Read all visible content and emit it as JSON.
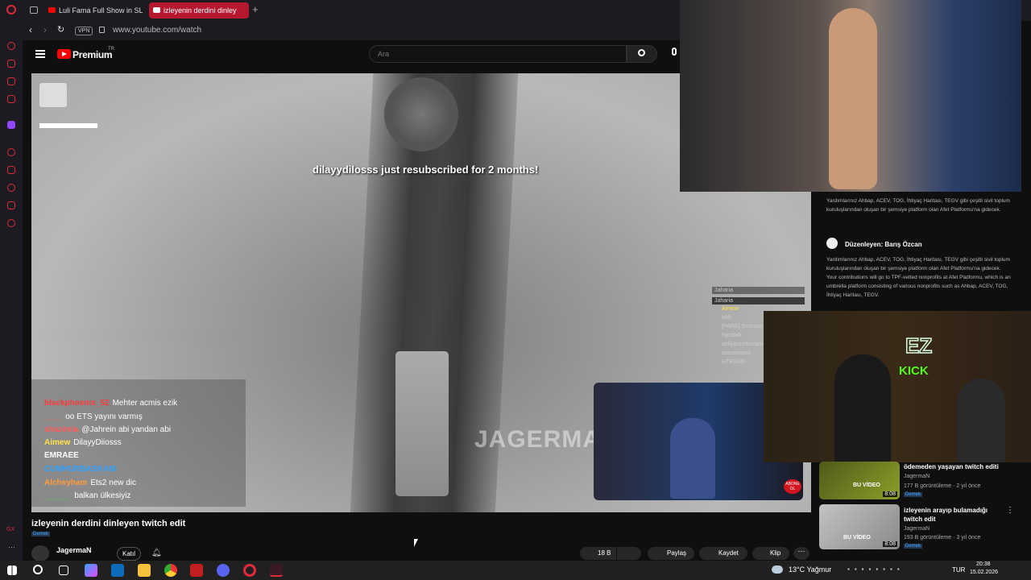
{
  "browser": {
    "tabs": [
      {
        "label": "Luli Fama Full Show in SLC"
      },
      {
        "label": "izleyenin derdini dinley"
      }
    ],
    "vpn_badge": "VPN",
    "url": "www.youtube.com/watch"
  },
  "youtube": {
    "brand": "Premium",
    "brand_sup": "TR",
    "search_placeholder": "Ara"
  },
  "video": {
    "sub_alert": "dilayydilosss just resubscribed for 2 months!",
    "watermark": "JAGERMAN",
    "chat": [
      {
        "user": "blackphoenix_52",
        "color": "#ff3b3b",
        "msg": "Mehter acmis ezik"
      },
      {
        "user": "____",
        "color": "#ff6a3b",
        "msg": "oo ETS yayını varmış"
      },
      {
        "user": "shazimia",
        "color": "#ff5a5a",
        "msg": "@Jahrein abi yandan abi"
      },
      {
        "user": "Aimew",
        "color": "#ffe24a",
        "msg": "DilayyDiiosss"
      },
      {
        "user": "EMRAEE",
        "color": "#ffffff",
        "msg": ""
      },
      {
        "user": "CUMHURBASKANI",
        "color": "#2ea0ff",
        "msg": ""
      },
      {
        "user": "Alcheyham",
        "color": "#ff9a3b",
        "msg": "Ets2 new dic"
      },
      {
        "user": "______",
        "color": "#3bd16a",
        "msg": "balkan ülkesiyiz"
      }
    ],
    "viewer_list": {
      "title": "Jaharia",
      "header": "Jaharia",
      "names": [
        "Aimew",
        "Milh",
        "[PARS] Smizara",
        "Njordah",
        "anliyorumhocam",
        "mavisimsek",
        "HTB3345"
      ]
    },
    "kick_logo": "EZ",
    "kick_text": "KICK",
    "abone": "ABONE OL"
  },
  "below": {
    "title": "izleyenin derdini dinleyen twitch edit",
    "desc_tag": "Demek",
    "channel": "JagermaN",
    "join_label": "Katıl",
    "like_count": "18 B",
    "share_label": "Paylaş",
    "save_label": "Kaydet",
    "clip_label": "Klip"
  },
  "description": {
    "text1": "Yardımlarınız Ahbap, ACEV, TOG, İhtiyaç Haritası, TEGV gibi çeşitli sivil toplum kuruluşlarından oluşan bir şemsiye platform olan Afet Platformu'na gidecek.",
    "editor": "Düzenleyen: Barış Özcan",
    "text2": "Yardımlarınız Ahbap, ACEV, TOG, İhtiyaç Haritası, TEGV gibi çeşitli sivil toplum kuruluşlarından oluşan bir şemsiye platform olan Afet Platformu'na gidecek. Your contributions will go to TPF-vetted nonprofits at Afet Platformu, which is an umbrella platform consisting of various nonprofits such as Ahbap, ACEV, TOG, İhtiyaç Haritası, TEGV."
  },
  "recommended": [
    {
      "title": "ödemeden yaşayan twitch editi",
      "channel": "JagermaN",
      "meta": "177 B görüntüleme · 2 yıl önce",
      "tag": "Demek",
      "duration": "8:08",
      "thumb_text": "BU VİDEO"
    },
    {
      "title": "izleyenin arayıp bulamadığı twitch edit",
      "channel": "JagermaN",
      "meta": "193 B görüntüleme · 3 yıl önce",
      "tag": "Demek",
      "duration": "8:08",
      "thumb_text": "BU VİDEO"
    }
  ],
  "taskbar": {
    "weather": "13°C Yağmur",
    "lang": "TUR",
    "time": "20:38",
    "date": "15.02.2026"
  }
}
